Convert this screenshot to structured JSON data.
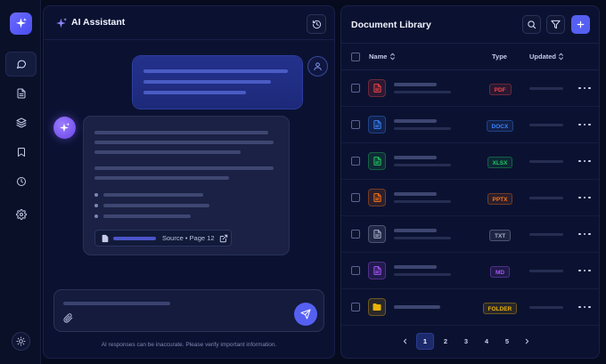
{
  "colors": {
    "accent": "#5560f2",
    "background": "#070b1e",
    "panel": "#0b1231",
    "user_bubble": "#24318c",
    "ai_bubble": "#1a2144"
  },
  "rail": {
    "logo_icon": "sparkle-icon",
    "items": [
      {
        "name": "chat",
        "icon": "chat-bubble-icon",
        "active": true
      },
      {
        "name": "documents",
        "icon": "document-icon",
        "active": false
      },
      {
        "name": "layers",
        "icon": "layers-icon",
        "active": false
      },
      {
        "name": "bookmarks",
        "icon": "bookmark-icon",
        "active": false
      },
      {
        "name": "history",
        "icon": "clock-icon",
        "active": false
      },
      {
        "name": "settings",
        "icon": "gear-icon",
        "active": false
      }
    ],
    "theme_icon": "sun-icon"
  },
  "chat": {
    "title": "AI Assistant",
    "source": {
      "label": "Source • Page 12"
    },
    "composer": {
      "send_icon": "send-icon",
      "attach_icon": "paperclip-icon"
    },
    "disclaimer": "AI responses can be inaccurate. Please verify important information."
  },
  "library": {
    "title": "Document Library",
    "columns": {
      "name": "Name",
      "type": "Type",
      "updated": "Updated"
    },
    "rows": [
      {
        "type": "PDF",
        "icon": "pdf-file-icon",
        "color": "#ef4444"
      },
      {
        "type": "DOCX",
        "icon": "word-file-icon",
        "color": "#3b82f6"
      },
      {
        "type": "XLSX",
        "icon": "excel-file-icon",
        "color": "#22c55e"
      },
      {
        "type": "PPTX",
        "icon": "powerpoint-file-icon",
        "color": "#f97316"
      },
      {
        "type": "TXT",
        "icon": "text-file-icon",
        "color": "#a6adc8"
      },
      {
        "type": "MD",
        "icon": "markdown-file-icon",
        "color": "#a855f7"
      },
      {
        "type": "FOLDER",
        "icon": "folder-icon",
        "color": "#eab308"
      }
    ],
    "pagination": {
      "pages": [
        "1",
        "2",
        "3",
        "4",
        "5"
      ],
      "current": "1"
    }
  }
}
